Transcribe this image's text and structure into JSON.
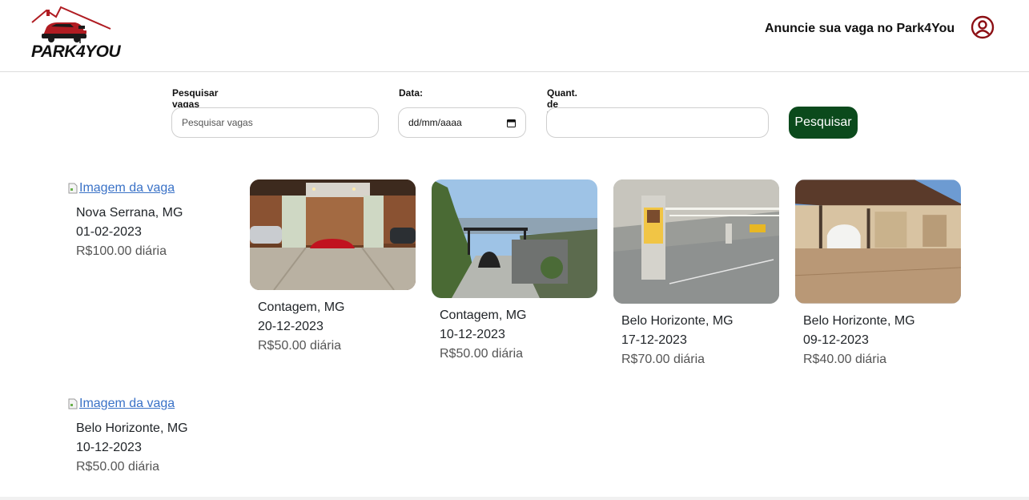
{
  "header": {
    "brand": "PARK4YOU",
    "announce_link": "Anuncie sua vaga no Park4You"
  },
  "search": {
    "query_label": "Pesquisar vagas",
    "query_placeholder": "Pesquisar vagas",
    "date_label": "Data:",
    "date_value": "dd/mm/aaaa",
    "vehicles_label": "Quant. de Veículos:",
    "vehicles_value": "",
    "button_label": "Pesquisar"
  },
  "listings": [
    {
      "image_alt": "Imagem da vaga",
      "city": "Nova Serrana, MG",
      "date": "01-02-2023",
      "price": "R$100.00 diária",
      "image": "broken"
    },
    {
      "image_alt": "Imagem da vaga",
      "city": "Contagem, MG",
      "date": "20-12-2023",
      "price": "R$50.00 diária",
      "image": "garage-interior-red-car"
    },
    {
      "image_alt": "Imagem da vaga",
      "city": "Contagem, MG",
      "date": "10-12-2023",
      "price": "R$50.00 diária",
      "image": "hillside-carport"
    },
    {
      "image_alt": "Imagem da vaga",
      "city": "Belo Horizonte, MG",
      "date": "17-12-2023",
      "price": "R$70.00 diária",
      "image": "underground-parking"
    },
    {
      "image_alt": "Imagem da vaga",
      "city": "Belo Horizonte, MG",
      "date": "09-12-2023",
      "price": "R$40.00 diária",
      "image": "house-carport-white-car"
    },
    {
      "image_alt": "Imagem da vaga",
      "city": "Belo Horizonte, MG",
      "date": "10-12-2023",
      "price": "R$50.00 diária",
      "image": "broken"
    }
  ],
  "colors": {
    "brand_red": "#b01c22",
    "button_green": "#0b4a1c",
    "link_blue": "#3a72c7"
  }
}
